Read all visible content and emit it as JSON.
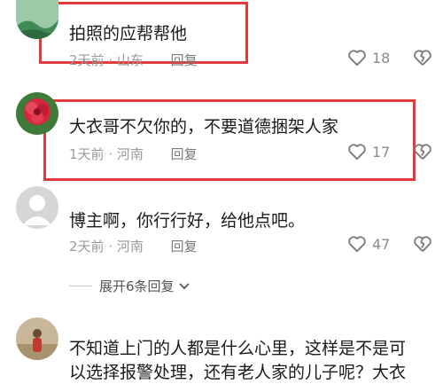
{
  "comments": [
    {
      "text": "拍照的应帮帮他",
      "time": "2天前",
      "location": "山东",
      "reply_label": "回复",
      "likes": "18",
      "avatar": "landscape-avatar-icon"
    },
    {
      "text": "大衣哥不欠你的，不要道德捆架人家",
      "time": "1天前",
      "location": "河南",
      "reply_label": "回复",
      "likes": "17",
      "avatar": "flower-avatar-icon"
    },
    {
      "text": "博主啊，你行行好，给他点吧。",
      "time": "2天前",
      "location": "河南",
      "reply_label": "回复",
      "likes": "47",
      "avatar": "default-avatar-icon"
    },
    {
      "text_line1": "不知道上门的人都是什么心里，这样是不是可",
      "text_line2": "以选择报警处理，还有老人家的儿子呢？大衣",
      "avatar": "person-photo-avatar-icon"
    }
  ],
  "expand_replies": "展开6条回复",
  "colors": {
    "highlight": "#e23b3b",
    "meta": "#9a9a9a"
  }
}
